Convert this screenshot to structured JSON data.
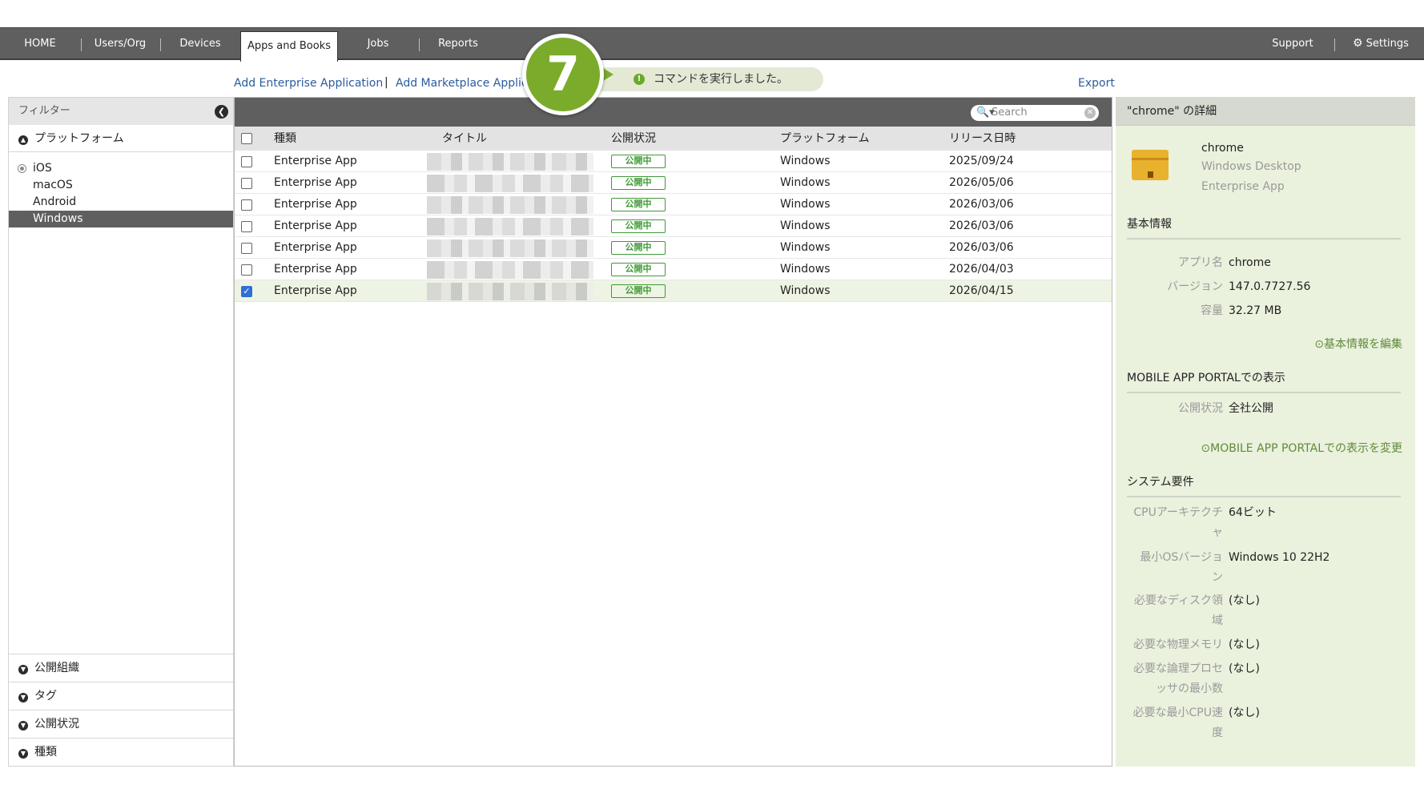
{
  "nav": {
    "items": [
      "HOME",
      "Users/Org",
      "Devices",
      "Apps and Books",
      "Jobs",
      "Reports"
    ],
    "active": "Apps and Books",
    "support": "Support",
    "settings": "Settings"
  },
  "actions": {
    "add_enterprise": "Add Enterprise Application",
    "separator": "|",
    "add_marketplace": "Add Marketplace Applic",
    "export": "Export"
  },
  "toast": {
    "message": "コマンドを実行しました。",
    "icon": "!"
  },
  "step_badge": "7",
  "filter": {
    "title": "フィルター",
    "platform_section": "プラットフォーム",
    "platforms": [
      "iOS",
      "macOS",
      "Android",
      "Windows"
    ],
    "selected_platform": "Windows",
    "bottom_sections": [
      "公開組織",
      "タグ",
      "公開状況",
      "種類"
    ]
  },
  "search": {
    "placeholder": "Search"
  },
  "table": {
    "headers": [
      "種類",
      "タイトル",
      "公開状況",
      "プラットフォーム",
      "リリース日時"
    ],
    "rows": [
      {
        "type": "Enterprise App",
        "status": "公開中",
        "platform": "Windows",
        "date": "2025/09/24",
        "checked": false
      },
      {
        "type": "Enterprise App",
        "status": "公開中",
        "platform": "Windows",
        "date": "2026/05/06",
        "checked": false
      },
      {
        "type": "Enterprise App",
        "status": "公開中",
        "platform": "Windows",
        "date": "2026/03/06",
        "checked": false
      },
      {
        "type": "Enterprise App",
        "status": "公開中",
        "platform": "Windows",
        "date": "2026/03/06",
        "checked": false
      },
      {
        "type": "Enterprise App",
        "status": "公開中",
        "platform": "Windows",
        "date": "2026/03/06",
        "checked": false
      },
      {
        "type": "Enterprise App",
        "status": "公開中",
        "platform": "Windows",
        "date": "2026/04/03",
        "checked": false
      },
      {
        "type": "Enterprise App",
        "status": "公開中",
        "platform": "Windows",
        "date": "2026/04/15",
        "checked": true
      }
    ]
  },
  "detail": {
    "header": "\"chrome\" の詳細",
    "app_name": "chrome",
    "app_platform": "Windows Desktop",
    "app_type": "Enterprise App",
    "basic_section": "基本情報",
    "basic": [
      {
        "label": "アプリ名",
        "value": "chrome"
      },
      {
        "label": "バージョン",
        "value": "147.0.7727.56"
      },
      {
        "label": "容量",
        "value": "32.27 MB"
      }
    ],
    "edit_basic": "基本情報を編集",
    "portal_section": "MOBILE APP PORTALでの表示",
    "portal": [
      {
        "label": "公開状況",
        "value": "全社公開"
      }
    ],
    "edit_portal": "MOBILE APP PORTALでの表示を変更",
    "system_section": "システム要件",
    "system": [
      {
        "label1": "CPUアーキテクチ",
        "label2": "ャ",
        "value": "64ビット"
      },
      {
        "label1": "最小OSバージョ",
        "label2": "ン",
        "value": "Windows 10 22H2"
      },
      {
        "label1": "必要なディスク領",
        "label2": "域",
        "value": "(なし)"
      },
      {
        "label1": "必要な物理メモリ",
        "label2": "",
        "value": "(なし)"
      },
      {
        "label1": "必要な論理プロセ",
        "label2": "ッサの最小数",
        "value": "(なし)"
      },
      {
        "label1": "必要な最小CPU速",
        "label2": "度",
        "value": "(なし)"
      }
    ]
  }
}
